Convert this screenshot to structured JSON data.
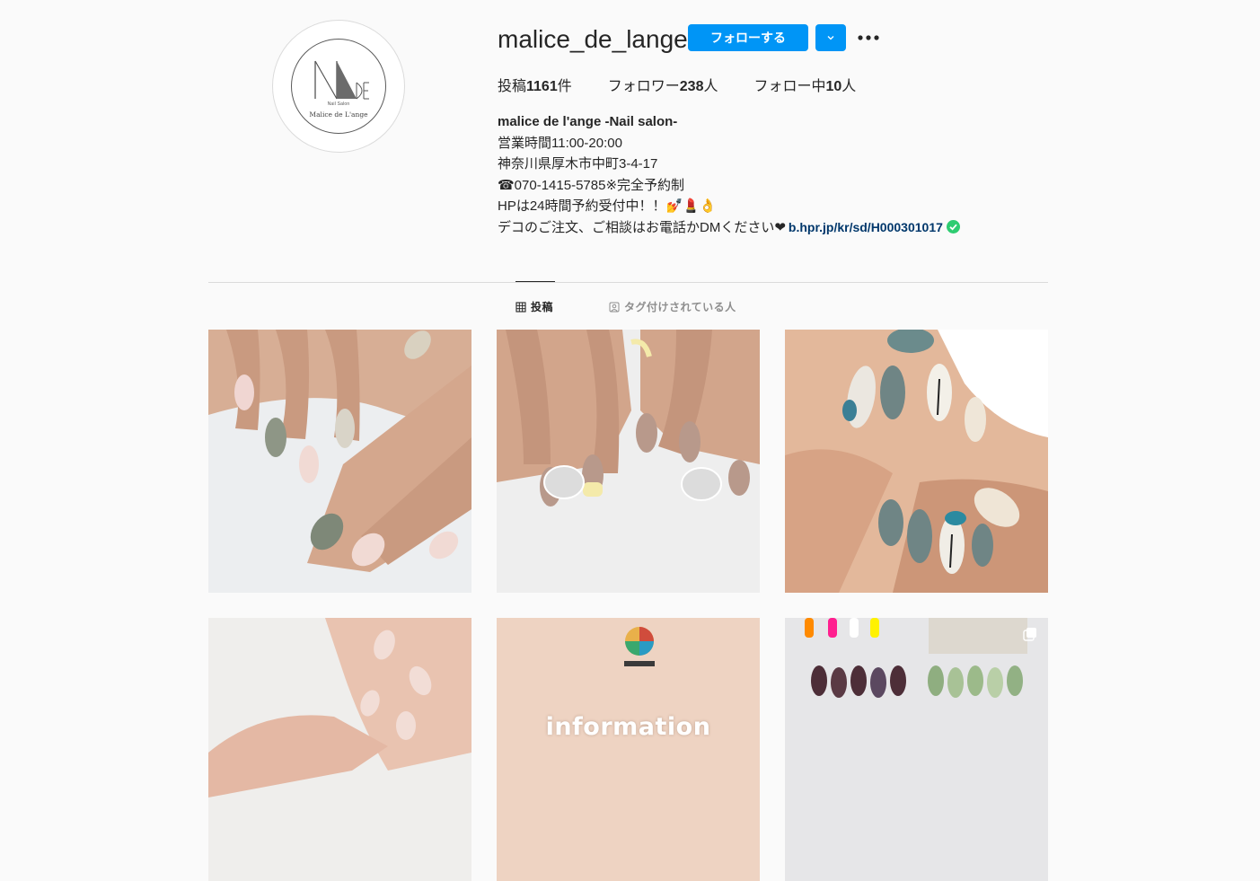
{
  "profile": {
    "username": "malice_de_lange",
    "logo": {
      "small_text": "Nail Salon",
      "name_text": "Malice de L'ange"
    },
    "follow_label": "フォローする",
    "stats": {
      "posts_label": "投稿",
      "posts_count": "1161",
      "posts_unit": "件",
      "followers_label": "フォロワー",
      "followers_count": "238",
      "followers_unit": "人",
      "following_label": "フォロー中",
      "following_count": "10",
      "following_unit": "人"
    },
    "bio": {
      "name": "malice de l'ange -Nail salon-",
      "line1": "営業時間11:00-20:00",
      "line2": "神奈川県厚木市中町3-4-17",
      "line3": "☎070-1415-5785※完全予約制",
      "line4": "HPは24時間予約受付中！！💅💄👌",
      "line5": "デコのご注文、ご相談はお電話かDMください❤",
      "link": "b.hpr.jp/kr/sd/H000301017"
    }
  },
  "tabs": {
    "posts": "投稿",
    "tagged": "タグ付けされている人"
  },
  "posts": {
    "info_caption": "information"
  },
  "colors": {
    "accent": "#0095f6",
    "link": "#00376b",
    "verified": "#2ecc71",
    "background": "#fafafa"
  },
  "icons": [
    "chevron-down-icon",
    "more-icon",
    "grid-icon",
    "tagged-icon",
    "verified-icon",
    "multiple-posts-icon"
  ]
}
